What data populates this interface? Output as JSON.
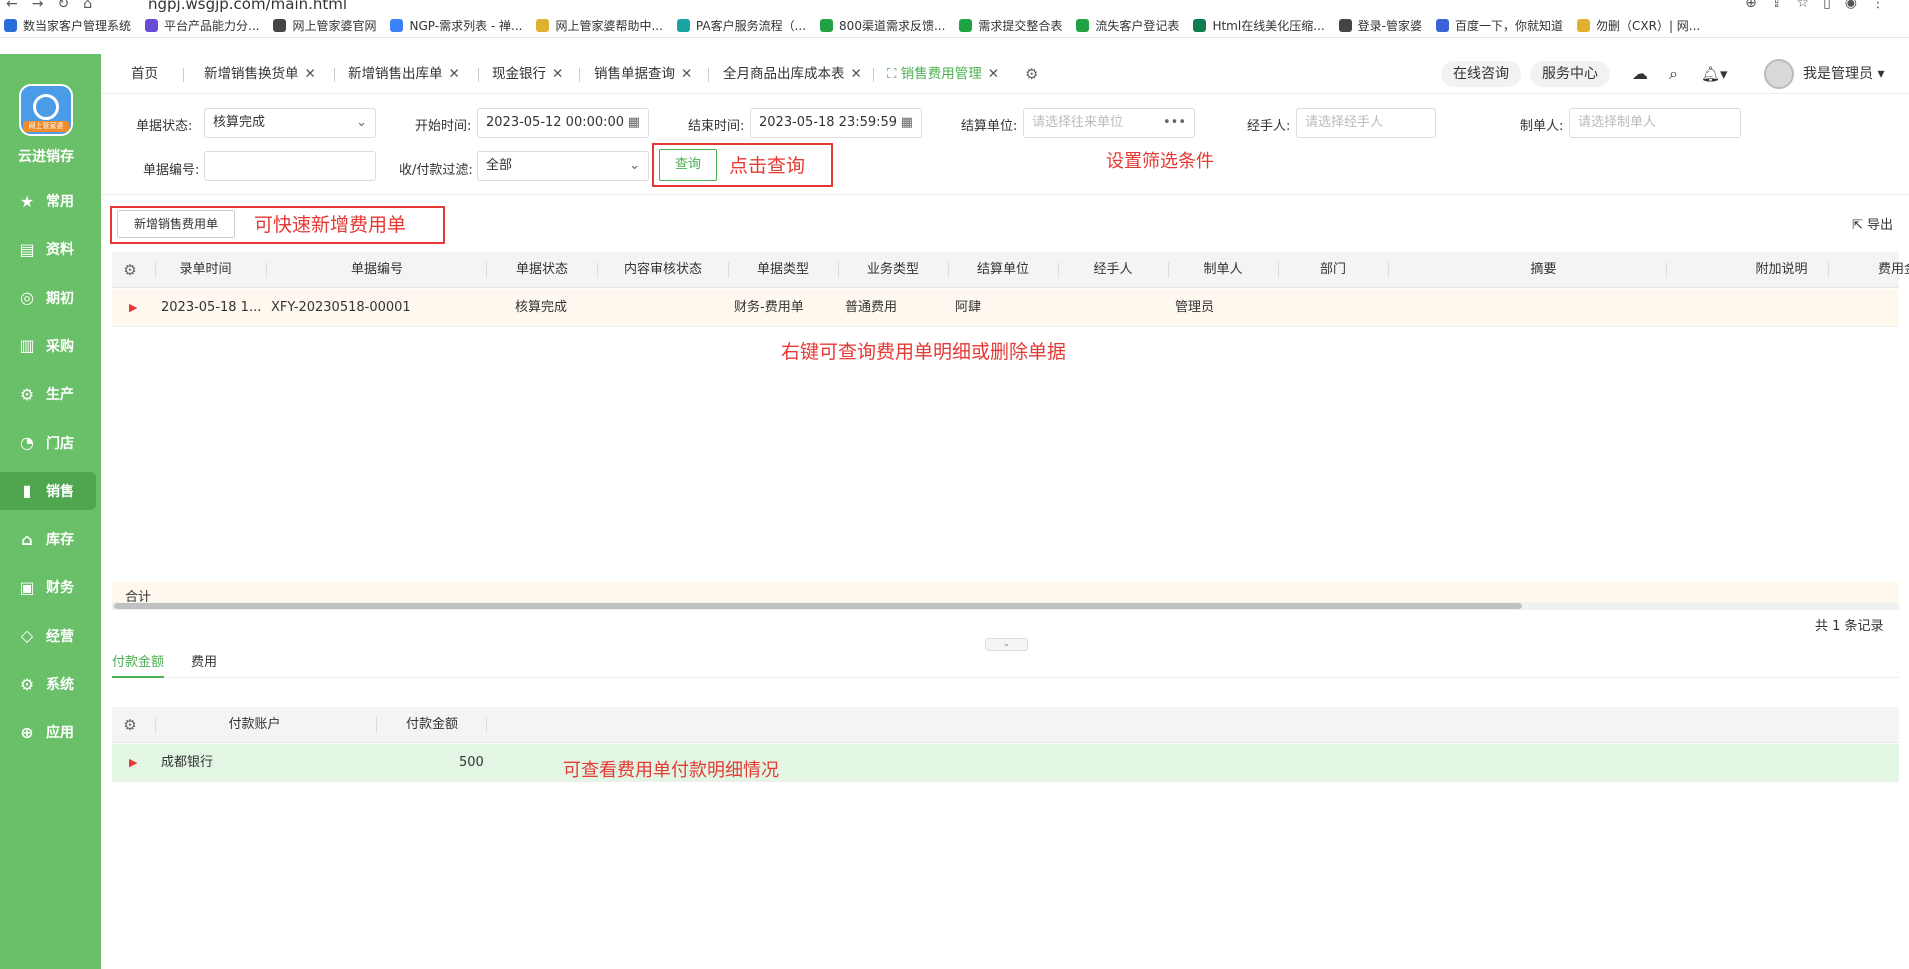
{
  "browser": {
    "url": "ngpj.wsgjp.com/main.html"
  },
  "bookmarks": [
    {
      "label": "数当家客户管理系统",
      "color": "#2a6dd6"
    },
    {
      "label": "平台产品能力分...",
      "color": "#6a4bd6"
    },
    {
      "label": "网上管家婆官网",
      "color": "#444444"
    },
    {
      "label": "NGP-需求列表 - 禅...",
      "color": "#3b82f6"
    },
    {
      "label": "网上管家婆帮助中...",
      "color": "#e0b030"
    },
    {
      "label": "PA客户服务流程（...",
      "color": "#1aa3a3"
    },
    {
      "label": "800渠道需求反馈...",
      "color": "#21a344"
    },
    {
      "label": "需求提交整合表",
      "color": "#21a344"
    },
    {
      "label": "流失客户登记表",
      "color": "#21a344"
    },
    {
      "label": "Html在线美化压缩...",
      "color": "#0f7d4f"
    },
    {
      "label": "登录-管家婆",
      "color": "#444444"
    },
    {
      "label": "百度一下，你就知道",
      "color": "#3b62d6"
    },
    {
      "label": "勿删（CXR）| 网...",
      "color": "#e0b030"
    }
  ],
  "sidebar": {
    "brand": "云进销存",
    "logo_tag": "网上管家婆",
    "items": [
      {
        "label": "常用",
        "icon": "★"
      },
      {
        "label": "资料",
        "icon": "▤"
      },
      {
        "label": "期初",
        "icon": "◎"
      },
      {
        "label": "采购",
        "icon": "▥"
      },
      {
        "label": "生产",
        "icon": "⚙"
      },
      {
        "label": "门店",
        "icon": "◔"
      },
      {
        "label": "销售",
        "icon": "▮"
      },
      {
        "label": "库存",
        "icon": "⌂"
      },
      {
        "label": "财务",
        "icon": "▣"
      },
      {
        "label": "经营",
        "icon": "◇"
      },
      {
        "label": "系统",
        "icon": "⚙"
      },
      {
        "label": "应用",
        "icon": "⊕"
      }
    ]
  },
  "tabs": [
    {
      "label": "首页"
    },
    {
      "label": "新增销售换货单"
    },
    {
      "label": "新增销售出库单"
    },
    {
      "label": "现金银行"
    },
    {
      "label": "销售单据查询"
    },
    {
      "label": "全月商品出库成本表"
    },
    {
      "label": "销售费用管理"
    }
  ],
  "header": {
    "online_consult": "在线咨询",
    "service_center": "服务中心",
    "user_name": "我是管理员"
  },
  "filters": {
    "status_label": "单据状态:",
    "status_value": "核算完成",
    "start_label": "开始时间:",
    "start_value": "2023-05-12 00:00:00",
    "end_label": "结束时间:",
    "end_value": "2023-05-18 23:59:59",
    "unit_label": "结算单位:",
    "unit_placeholder": "请选择往来单位",
    "handler_label": "经手人:",
    "handler_placeholder": "请选择经手人",
    "maker_label": "制单人:",
    "maker_placeholder": "请选择制单人",
    "number_label": "单据编号:",
    "payfilter_label": "收/付款过滤:",
    "payfilter_value": "全部",
    "query_button": "查询"
  },
  "annotations": {
    "query_note": "点击查询",
    "filter_note": "设置筛选条件",
    "new_note": "可快速新增费用单",
    "rightclick_note": "右键可查询费用单明细或删除单据",
    "payment_note": "可查看费用单付款明细情况"
  },
  "toolbar": {
    "new_expense": "新增销售费用单",
    "export": "导出"
  },
  "grid": {
    "columns": [
      "录单时间",
      "单据编号",
      "单据状态",
      "内容审核状态",
      "单据类型",
      "业务类型",
      "结算单位",
      "经手人",
      "制单人",
      "部门",
      "摘要",
      "附加说明",
      "费用金额"
    ],
    "rows": [
      {
        "time": "2023-05-18 1...",
        "number": "XFY-20230518-00001",
        "status": "核算完成",
        "audit": "",
        "type": "财务-费用单",
        "biz": "普通费用",
        "unit": "阿肆",
        "handler": "",
        "maker": "管理员"
      }
    ],
    "sum_label": "合计",
    "count": "共 1 条记录"
  },
  "subtabs": [
    "付款金额",
    "费用"
  ],
  "pay_grid": {
    "columns": [
      "付款账户",
      "付款金额"
    ],
    "rows": [
      {
        "account": "成都银行",
        "amount": "500"
      }
    ]
  }
}
